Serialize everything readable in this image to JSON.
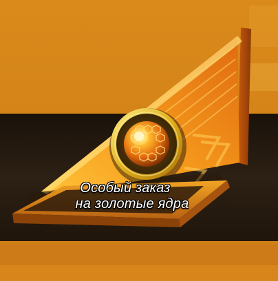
{
  "offer": {
    "title_line1": "Особый заказ",
    "title_line2": "на золотые ядра"
  },
  "icons": {
    "main": "golden-cannonball-icon"
  },
  "colors": {
    "background_top": "#d98a1a",
    "background_bottom": "#c9761a",
    "band_dark": "#2a1c10",
    "card_orange": "#f08a18",
    "card_gold": "#ffb326",
    "medallion_rim": "#e8c020",
    "medallion_inner": "#5a3a08",
    "orb_core": "#ffb020"
  }
}
